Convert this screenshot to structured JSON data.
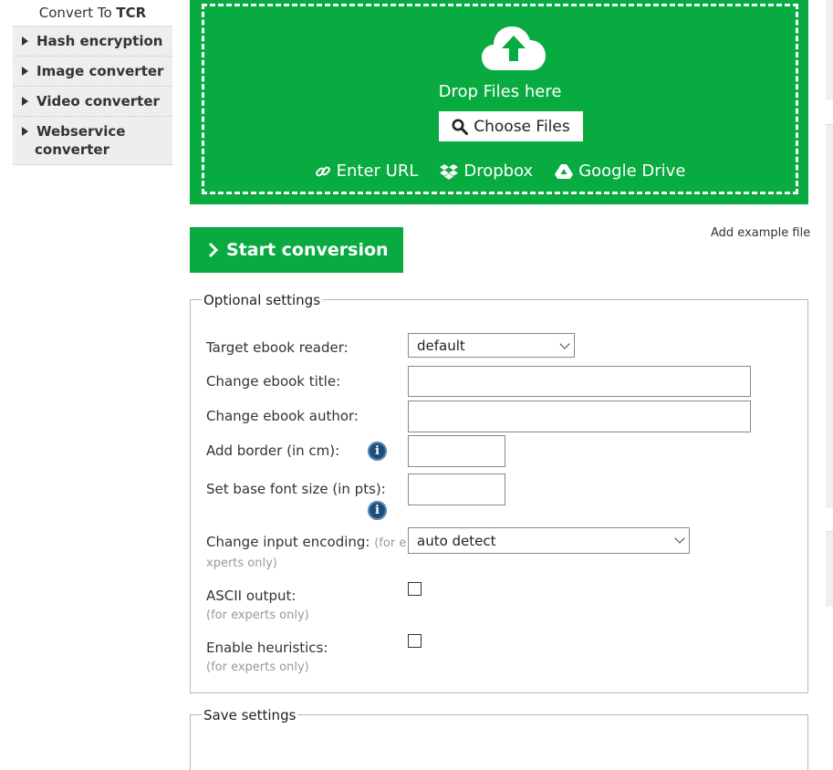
{
  "sidebar": {
    "top_prefix": "Convert To ",
    "top_bold": "TCR",
    "items": [
      {
        "label": "Hash encryption"
      },
      {
        "label": "Image converter"
      },
      {
        "label": "Video converter"
      },
      {
        "label_line1": "Webservice",
        "label_line2": "converter"
      }
    ]
  },
  "upload": {
    "drop_text": "Drop Files here",
    "choose_label": "Choose Files",
    "url_label": "Enter URL",
    "dropbox_label": "Dropbox",
    "gdrive_label": "Google Drive"
  },
  "actions": {
    "start_label": "Start conversion",
    "example_label": "Add example file"
  },
  "optional": {
    "legend": "Optional settings",
    "reader_label": "Target ebook reader:",
    "reader_value": "default",
    "title_label": "Change ebook title:",
    "title_value": "",
    "author_label": "Change ebook author:",
    "author_value": "",
    "border_label": "Add border (in cm):",
    "border_value": "",
    "font_label": "Set base font size (in pts):",
    "font_value": "",
    "encoding_label": "Change input encoding:",
    "encoding_hint_a": "(for e",
    "encoding_hint_b": "xperts only)",
    "encoding_value": "auto detect",
    "ascii_label": "ASCII output:",
    "ascii_hint": "(for experts only)",
    "heuristics_label": "Enable heuristics:",
    "heuristics_hint": "(for experts only)"
  },
  "save": {
    "legend": "Save settings"
  },
  "colors": {
    "brand_green": "#07ab3f",
    "info_blue": "#1b4f7a"
  }
}
